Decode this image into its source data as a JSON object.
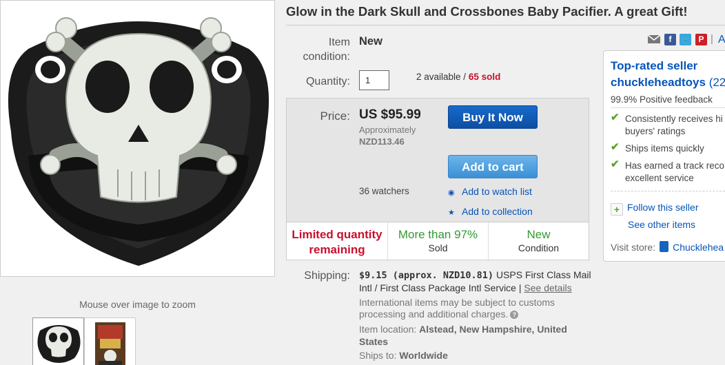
{
  "gallery": {
    "zoom_hint": "Mouse over image to zoom"
  },
  "listing": {
    "title": "Glow in the Dark Skull and Crossbones Baby Pacifier. A great Gift!",
    "condition_label": "Item condition:",
    "condition_value": "New",
    "quantity_label": "Quantity:",
    "quantity_value": "1",
    "available": "2 available /",
    "sold": "65 sold"
  },
  "price": {
    "label": "Price:",
    "value": "US $95.99",
    "approx_label": "Approximately",
    "approx_value": "NZD113.46",
    "buy_now": "Buy It Now",
    "add_to_cart": "Add to cart",
    "watchers": "36 watchers",
    "add_watch": "Add to watch list",
    "add_collection": "Add to collection"
  },
  "stats": {
    "limited_1": "Limited quantity",
    "limited_2": "remaining",
    "positive_big": "More than 97%",
    "positive_small": "Sold",
    "new_big": "New",
    "new_small": "Condition"
  },
  "shipping": {
    "label": "Shipping:",
    "cost": "$9.15 (approx. NZD10.81)",
    "service": " USPS First Class Mail Intl / First Class Package Intl Service | ",
    "details": "See details",
    "intl_note": "International items may be subject to customs processing and additional charges.",
    "location_label": "Item location: ",
    "location": "Alstead, New Hampshire, United States",
    "ships_label": "Ships to: ",
    "ships_to": "Worldwide"
  },
  "share": {
    "separator": "|",
    "partial": "A"
  },
  "seller": {
    "top_rated": "Top-rated seller",
    "name": "chuckleheadtoys",
    "score_partial": "(22",
    "positive": "99.9% Positive feedback",
    "feature_1a": "Consistently receives hi",
    "feature_1b": "buyers' ratings",
    "feature_2": "Ships items quickly",
    "feature_3a": "Has earned a track reco",
    "feature_3b": "excellent service",
    "follow": "Follow this seller",
    "see_other": "See other items",
    "visit_label": "Visit store:",
    "store_name": "Chucklehea"
  },
  "colors": {
    "link": "#0654ba",
    "sold_red": "#c8102e",
    "positive_green": "#339933",
    "buy_button": "#0c4fa3",
    "cart_button": "#3b8fd6"
  }
}
